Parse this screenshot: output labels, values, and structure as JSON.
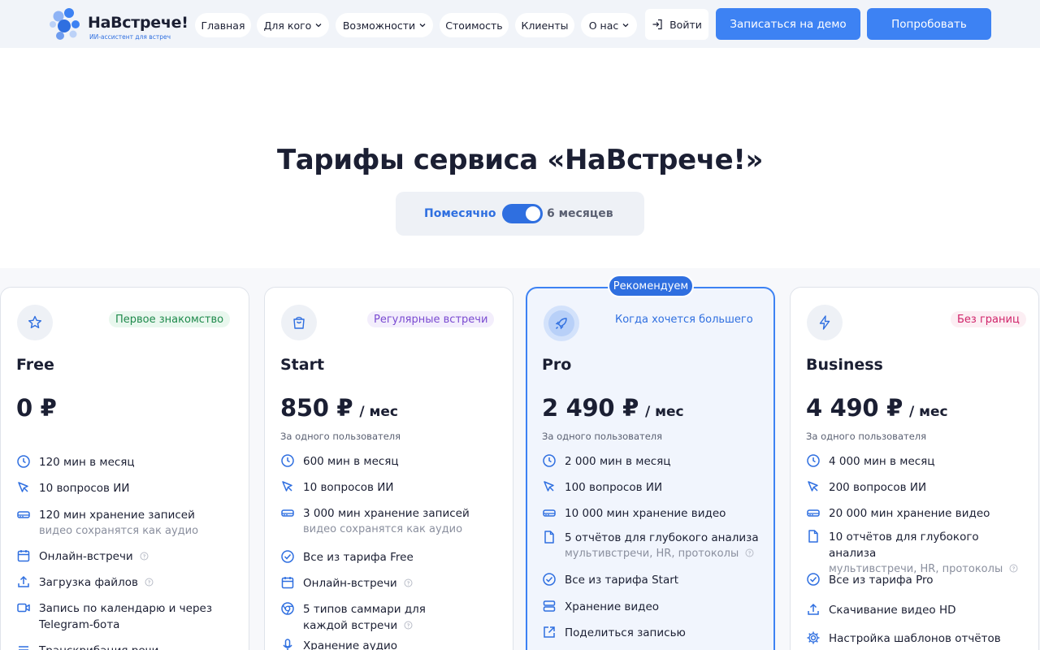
{
  "brand": {
    "name": "НаВстрече!",
    "tagline": "ИИ-ассистент для встреч",
    "color": "#3d82f3"
  },
  "nav": {
    "items": [
      {
        "label": "Главная",
        "dropdown": false
      },
      {
        "label": "Для кого",
        "dropdown": true
      },
      {
        "label": "Возможности",
        "dropdown": true
      },
      {
        "label": "Стоимость",
        "dropdown": false
      },
      {
        "label": "Клиенты",
        "dropdown": false
      },
      {
        "label": "О нас",
        "dropdown": true
      }
    ],
    "login_label": "Войти",
    "demo_label": "Записаться на демо",
    "try_label": "Попробовать"
  },
  "hero": {
    "title": "Тарифы сервиса «НаВстрече!»",
    "billing_toggle": {
      "left_label": "Помесячно",
      "right_label": "6 месяцев",
      "state": "on"
    }
  },
  "recommended_label": "Рекомендуем",
  "plans": [
    {
      "name": "Free",
      "badge": "Первое знакомство",
      "icon": "star-icon",
      "price": "0 ₽",
      "period": "",
      "note": "",
      "features": [
        {
          "icon": "clock-icon",
          "text": "120 мин в месяц"
        },
        {
          "icon": "cursor-icon",
          "text": "10 вопросов ИИ"
        },
        {
          "icon": "drive-icon",
          "text": "120 мин хранение записей",
          "sub": "видео сохранятся как аудио"
        },
        {
          "icon": "calendar-icon",
          "text": "Онлайн-встречи",
          "info": true
        },
        {
          "icon": "upload-icon",
          "text": "Загрузка файлов",
          "info": true
        },
        {
          "icon": "video-icon",
          "text": "Запись по календарю и через Telegram-бота"
        },
        {
          "icon": "list-icon",
          "text": "Транскрибация речи"
        }
      ]
    },
    {
      "name": "Start",
      "badge": "Регулярные встречи",
      "icon": "bag-icon",
      "price": "850 ₽",
      "period": "/ мес",
      "note": "За одного пользователя",
      "features": [
        {
          "icon": "clock-icon",
          "text": "600 мин в месяц"
        },
        {
          "icon": "cursor-icon",
          "text": "10 вопросов ИИ"
        },
        {
          "icon": "drive-icon",
          "text": "3 000 мин хранение записей",
          "sub": "видео сохранятся как аудио"
        },
        {
          "icon": "check-circle-icon",
          "text": "Все из тарифа Free"
        },
        {
          "icon": "calendar-icon",
          "text": "Онлайн-встречи",
          "info": true
        },
        {
          "icon": "chrome-icon",
          "text": "5 типов саммари для каждой встречи",
          "info": true
        },
        {
          "icon": "mic-icon",
          "text": "Хранение аудио"
        }
      ]
    },
    {
      "name": "Pro",
      "badge": "Когда хочется большего",
      "icon": "rocket-icon",
      "price": "2 490 ₽",
      "period": "/ мес",
      "note": "За одного пользователя",
      "features": [
        {
          "icon": "clock-icon",
          "text": "2 000 мин в месяц"
        },
        {
          "icon": "cursor-icon",
          "text": "100 вопросов ИИ"
        },
        {
          "icon": "drive-icon",
          "text": "10 000 мин хранение видео"
        },
        {
          "icon": "file-icon",
          "text": "5 отчётов для глубокого анализа",
          "sub": "мультивстречи, HR, протоколы",
          "info": true
        },
        {
          "icon": "check-circle-icon",
          "text": "Все из тарифа Start"
        },
        {
          "icon": "storage-icon",
          "text": "Хранение видео"
        },
        {
          "icon": "share-icon",
          "text": "Поделиться записью"
        }
      ]
    },
    {
      "name": "Business",
      "badge": "Без границ",
      "icon": "bolt-icon",
      "price": "4 490 ₽",
      "period": "/ мес",
      "note": "За одного пользователя",
      "features": [
        {
          "icon": "clock-icon",
          "text": "4 000 мин в месяц"
        },
        {
          "icon": "cursor-icon",
          "text": "200 вопросов ИИ"
        },
        {
          "icon": "drive-icon",
          "text": "20 000 мин хранение видео"
        },
        {
          "icon": "file-icon",
          "text": "10 отчётов для глубокого анализа",
          "sub": "мультивстречи, HR, протоколы",
          "info": true
        },
        {
          "icon": "check-circle-icon",
          "text": "Все из тарифа Pro"
        },
        {
          "icon": "upload-icon",
          "text": "Скачивание видео HD"
        },
        {
          "icon": "gear-icon",
          "text": "Настройка шаблонов отчётов"
        }
      ]
    }
  ]
}
